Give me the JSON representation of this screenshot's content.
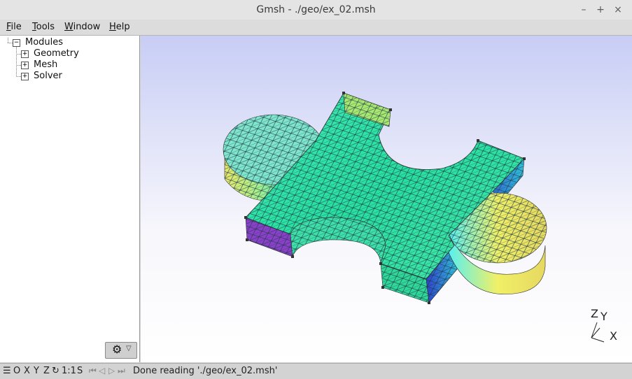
{
  "window": {
    "title": "Gmsh - ./geo/ex_02.msh",
    "minimize": "–",
    "maximize": "+",
    "close": "×"
  },
  "menubar": [
    {
      "u": "F",
      "rest": "ile"
    },
    {
      "u": "T",
      "rest": "ools"
    },
    {
      "u": "W",
      "rest": "indow"
    },
    {
      "u": "H",
      "rest": "elp"
    }
  ],
  "tree": {
    "root": "Modules",
    "root_toggle": "−",
    "children": [
      "Geometry",
      "Mesh",
      "Solver"
    ],
    "child_toggle": "+"
  },
  "gear_button": {
    "icon": "gear-icon",
    "glyph": "⚙",
    "arrow": "▽"
  },
  "axes": {
    "z": "Z",
    "y": "Y",
    "x": "X"
  },
  "statusbar": {
    "menu_icon": "☰",
    "view_buttons": [
      "O",
      "X",
      "Y",
      "Z"
    ],
    "rotate_icon": "↻",
    "scale": "1:1",
    "s_button": "S",
    "nav_icons": [
      "⏮",
      "◁",
      "▷",
      "⏭"
    ],
    "message": "Done reading './geo/ex_02.msh'"
  }
}
